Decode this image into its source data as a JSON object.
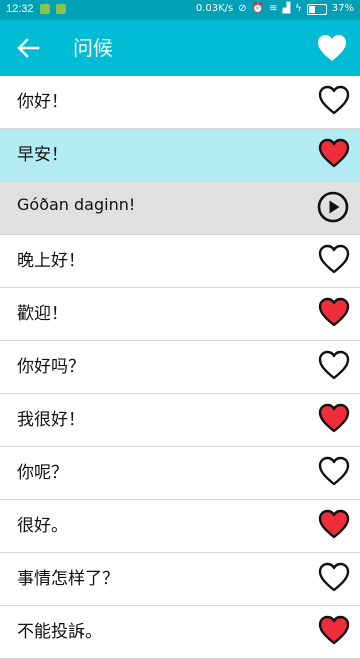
{
  "status_bar": {
    "time": "12:32",
    "network_speed": "0.03K/s",
    "battery": "37%",
    "battery_level": 0.37
  },
  "app_bar": {
    "title": "问候",
    "back_icon": "arrow-left-icon",
    "favorite_icon": "heart-filled-icon"
  },
  "colors": {
    "app_bar": "#00bcd4",
    "status_bar": "#00a0b6",
    "selected_row": "#b2ebf2",
    "translation_row": "#e0e0e0",
    "heart_red": "#f02d3a"
  },
  "phrases": [
    {
      "text": "你好！",
      "favorite": false
    },
    {
      "text": "早安！",
      "favorite": true,
      "selected": true
    },
    {
      "text": "Góðan daginn!",
      "type": "translation",
      "icon": "play-icon"
    },
    {
      "text": "晚上好！",
      "favorite": false
    },
    {
      "text": "歡迎！",
      "favorite": true
    },
    {
      "text": "你好吗？",
      "favorite": false
    },
    {
      "text": "我很好！",
      "favorite": true
    },
    {
      "text": "你呢？",
      "favorite": false
    },
    {
      "text": "很好。",
      "favorite": true
    },
    {
      "text": "事情怎样了？",
      "favorite": false
    },
    {
      "text": "不能投訴。",
      "favorite": true
    }
  ]
}
